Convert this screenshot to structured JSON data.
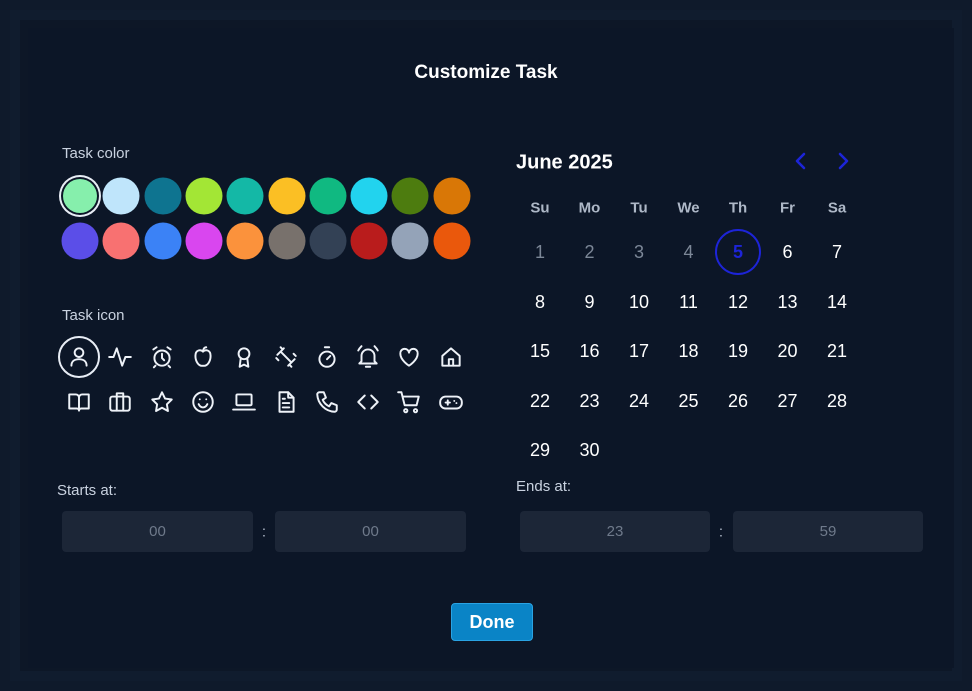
{
  "dialog": {
    "title": "Customize Task",
    "color_label": "Task color",
    "icon_label": "Task icon",
    "starts_label": "Starts at:",
    "ends_label": "Ends at:",
    "done_label": "Done"
  },
  "colors": {
    "row1": [
      "#86efac",
      "#bfe5fb",
      "#0e7490",
      "#a3e635",
      "#14b8a6",
      "#fbbf24",
      "#10b981",
      "#22d3ee",
      "#4d7c0f",
      "#d97706"
    ],
    "row2": [
      "#5b4ee8",
      "#f87171",
      "#3b82f6",
      "#d946ef",
      "#fb923c",
      "#78716c",
      "#334155",
      "#b91c1c",
      "#94a3b8",
      "#ea580c"
    ],
    "selected": "#86efac"
  },
  "icons": {
    "row1": [
      "user-icon",
      "activity-icon",
      "alarm-clock-icon",
      "apple-icon",
      "award-icon",
      "dumbbell-icon",
      "timer-icon",
      "bell-ring-icon",
      "heart-icon",
      "home-icon"
    ],
    "row2": [
      "book-open-icon",
      "briefcase-icon",
      "star-icon",
      "smile-icon",
      "laptop-icon",
      "file-text-icon",
      "phone-icon",
      "code-icon",
      "shopping-cart-icon",
      "gamepad-icon"
    ],
    "selected": "user-icon"
  },
  "calendar": {
    "month_label": "June 2025",
    "weekdays": [
      "Su",
      "Mo",
      "Tu",
      "We",
      "Th",
      "Fr",
      "Sa"
    ],
    "weeks": [
      [
        "1",
        "2",
        "3",
        "4",
        "5",
        "6",
        "7"
      ],
      [
        "8",
        "9",
        "10",
        "11",
        "12",
        "13",
        "14"
      ],
      [
        "15",
        "16",
        "17",
        "18",
        "19",
        "20",
        "21"
      ],
      [
        "22",
        "23",
        "24",
        "25",
        "26",
        "27",
        "28"
      ],
      [
        "29",
        "30"
      ]
    ],
    "today": "5",
    "past_days": [
      "1",
      "2",
      "3",
      "4"
    ]
  },
  "time": {
    "start_hour_placeholder": "00",
    "start_minute_placeholder": "00",
    "end_hour_placeholder": "23",
    "end_minute_placeholder": "59",
    "separator": ":"
  },
  "theme": {
    "accent": "#1d24d8",
    "button": "#0a84c6"
  }
}
